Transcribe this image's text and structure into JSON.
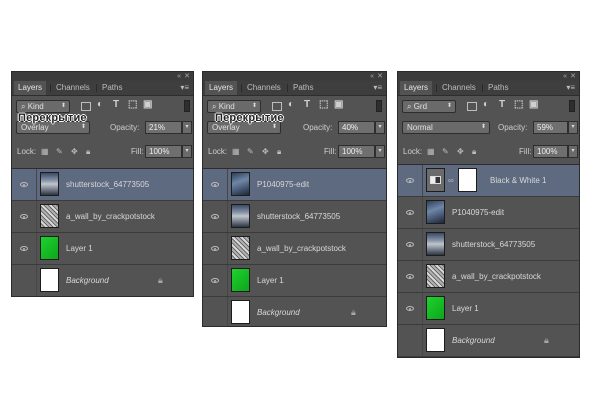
{
  "overlay_caption": "Перекрытие",
  "panels": [
    {
      "tabs": [
        "Layers",
        "Channels",
        "Paths"
      ],
      "filter": "Kind",
      "blend_mode": "Overlay",
      "opacity_label": "Opacity:",
      "opacity": "21%",
      "lock_label": "Lock:",
      "fill_label": "Fill:",
      "fill": "100%",
      "layers": [
        {
          "name": "shutterstock_64773505",
          "thumb": "stock",
          "selected": true
        },
        {
          "name": "a_wall_by_crackpotstock",
          "thumb": "wall"
        },
        {
          "name": "Layer 1",
          "thumb": "green"
        },
        {
          "name": "Background",
          "thumb": "white",
          "italic": true,
          "locked": true
        }
      ]
    },
    {
      "tabs": [
        "Layers",
        "Channels",
        "Paths"
      ],
      "filter": "Kind",
      "blend_mode": "Overlay",
      "opacity_label": "Opacity:",
      "opacity": "40%",
      "lock_label": "Lock:",
      "fill_label": "Fill:",
      "fill": "100%",
      "layers": [
        {
          "name": "P1040975-edit",
          "thumb": "blue",
          "selected": true
        },
        {
          "name": "shutterstock_64773505",
          "thumb": "stock"
        },
        {
          "name": "a_wall_by_crackpotstock",
          "thumb": "wall"
        },
        {
          "name": "Layer 1",
          "thumb": "green"
        },
        {
          "name": "Background",
          "thumb": "white",
          "italic": true,
          "locked": true
        }
      ]
    },
    {
      "tabs": [
        "Layers",
        "Channels",
        "Paths"
      ],
      "filter": "Grd",
      "blend_mode": "Normal",
      "opacity_label": "Opacity:",
      "opacity": "59%",
      "lock_label": "Lock:",
      "fill_label": "Fill:",
      "fill": "100%",
      "layers": [
        {
          "name": "Black & White 1",
          "thumb": "adj",
          "mask": true,
          "selected": true
        },
        {
          "name": "P1040975-edit",
          "thumb": "blue"
        },
        {
          "name": "shutterstock_64773505",
          "thumb": "stock"
        },
        {
          "name": "a_wall_by_crackpotstock",
          "thumb": "wall"
        },
        {
          "name": "Layer 1",
          "thumb": "green"
        },
        {
          "name": "Background",
          "thumb": "white",
          "italic": true,
          "locked": true
        }
      ]
    }
  ],
  "icons": {
    "collapse": "double-chevron-icon",
    "close": "close-icon",
    "panel_menu": "panel-menu-icon",
    "search": "search-icon",
    "visibility": "eye-icon",
    "lock": "lock-icon",
    "link": "chain-link-icon"
  },
  "colors": {
    "panel_bg": "#535353",
    "selected_row": "#5e6a7f",
    "green_layer": "#12c21f"
  }
}
